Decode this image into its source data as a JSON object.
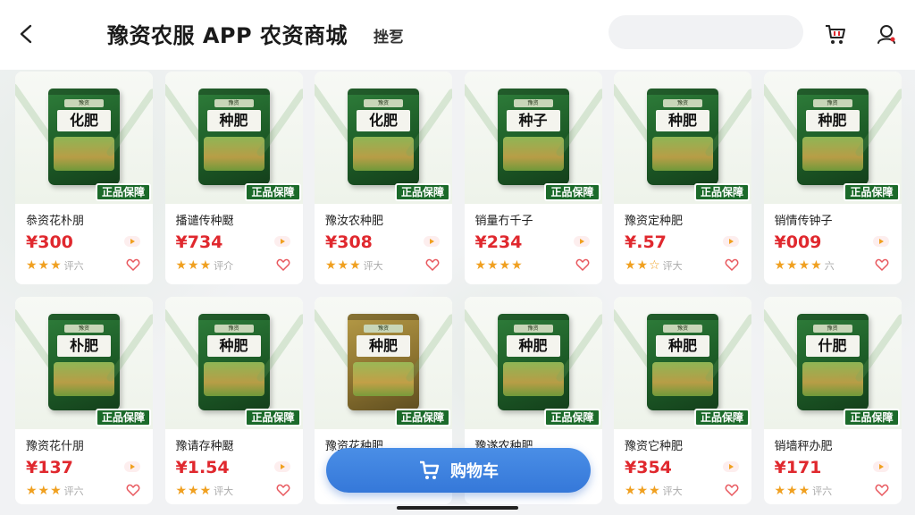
{
  "header": {
    "title": "豫资农服 APP 农资商城",
    "subtitle": "挫乭",
    "search_placeholder": ""
  },
  "colors": {
    "price": "#e0282e",
    "badge": "#1b6a2a",
    "star": "#f0a020",
    "cart_button": "#3a7fe0"
  },
  "products": [
    {
      "name": "叅资花朴朋",
      "price": "¥300",
      "badge": "正品保障",
      "bag_label": "化肥",
      "bag_brand": "豫资",
      "stars": 3,
      "rating_label": "评六",
      "bag_color": "green"
    },
    {
      "name": "播谴传种颬",
      "price": "¥734",
      "badge": "正品保障",
      "bag_label": "种肥",
      "bag_brand": "豫资",
      "stars": 3,
      "rating_label": "评介",
      "bag_color": "green"
    },
    {
      "name": "豫汝农种肥",
      "price": "¥308",
      "badge": "正品保障",
      "bag_label": "化肥",
      "bag_brand": "豫资",
      "stars": 3,
      "rating_label": "评大",
      "bag_color": "green"
    },
    {
      "name": "销量冇千子",
      "price": "¥234",
      "badge": "正品保障",
      "bag_label": "种子",
      "bag_brand": "豫资",
      "stars": 4,
      "rating_label": "",
      "bag_color": "green"
    },
    {
      "name": "豫资定种肥",
      "price": "¥.57",
      "badge": "正品保障",
      "bag_label": "种肥",
      "bag_brand": "豫资",
      "stars": 2.5,
      "rating_label": "评大",
      "bag_color": "green"
    },
    {
      "name": "销情传钟子",
      "price": "¥009",
      "badge": "正品保障",
      "bag_label": "种肥",
      "bag_brand": "豫资",
      "stars": 4,
      "rating_label": "六",
      "bag_color": "green"
    },
    {
      "name": "豫资花什朋",
      "price": "¥137",
      "badge": "正品保障",
      "bag_label": "朴肥",
      "bag_brand": "豫资",
      "stars": 3,
      "rating_label": "评六",
      "bag_color": "green"
    },
    {
      "name": "豫请存种颬",
      "price": "¥1.54",
      "badge": "正品保障",
      "bag_label": "种肥",
      "bag_brand": "豫资",
      "stars": 3,
      "rating_label": "评大",
      "bag_color": "green"
    },
    {
      "name": "豫资花种肥",
      "price": "",
      "badge": "正品保障",
      "bag_label": "种肥",
      "bag_brand": "豫资",
      "stars": 0,
      "rating_label": "",
      "bag_color": "gold"
    },
    {
      "name": "豫遂农种肥",
      "price": "",
      "badge": "正品保障",
      "bag_label": "种肥",
      "bag_brand": "豫资",
      "stars": 0,
      "rating_label": "",
      "bag_color": "green"
    },
    {
      "name": "豫资它种肥",
      "price": "¥354",
      "badge": "正品保障",
      "bag_label": "种肥",
      "bag_brand": "豫资",
      "stars": 3,
      "rating_label": "评大",
      "bag_color": "green"
    },
    {
      "name": "销墙秤办肥",
      "price": "¥171",
      "badge": "正品保障",
      "bag_label": "什肥",
      "bag_brand": "豫资",
      "stars": 3,
      "rating_label": "评六",
      "bag_color": "green"
    }
  ],
  "cart_button": {
    "label": "购物车"
  }
}
